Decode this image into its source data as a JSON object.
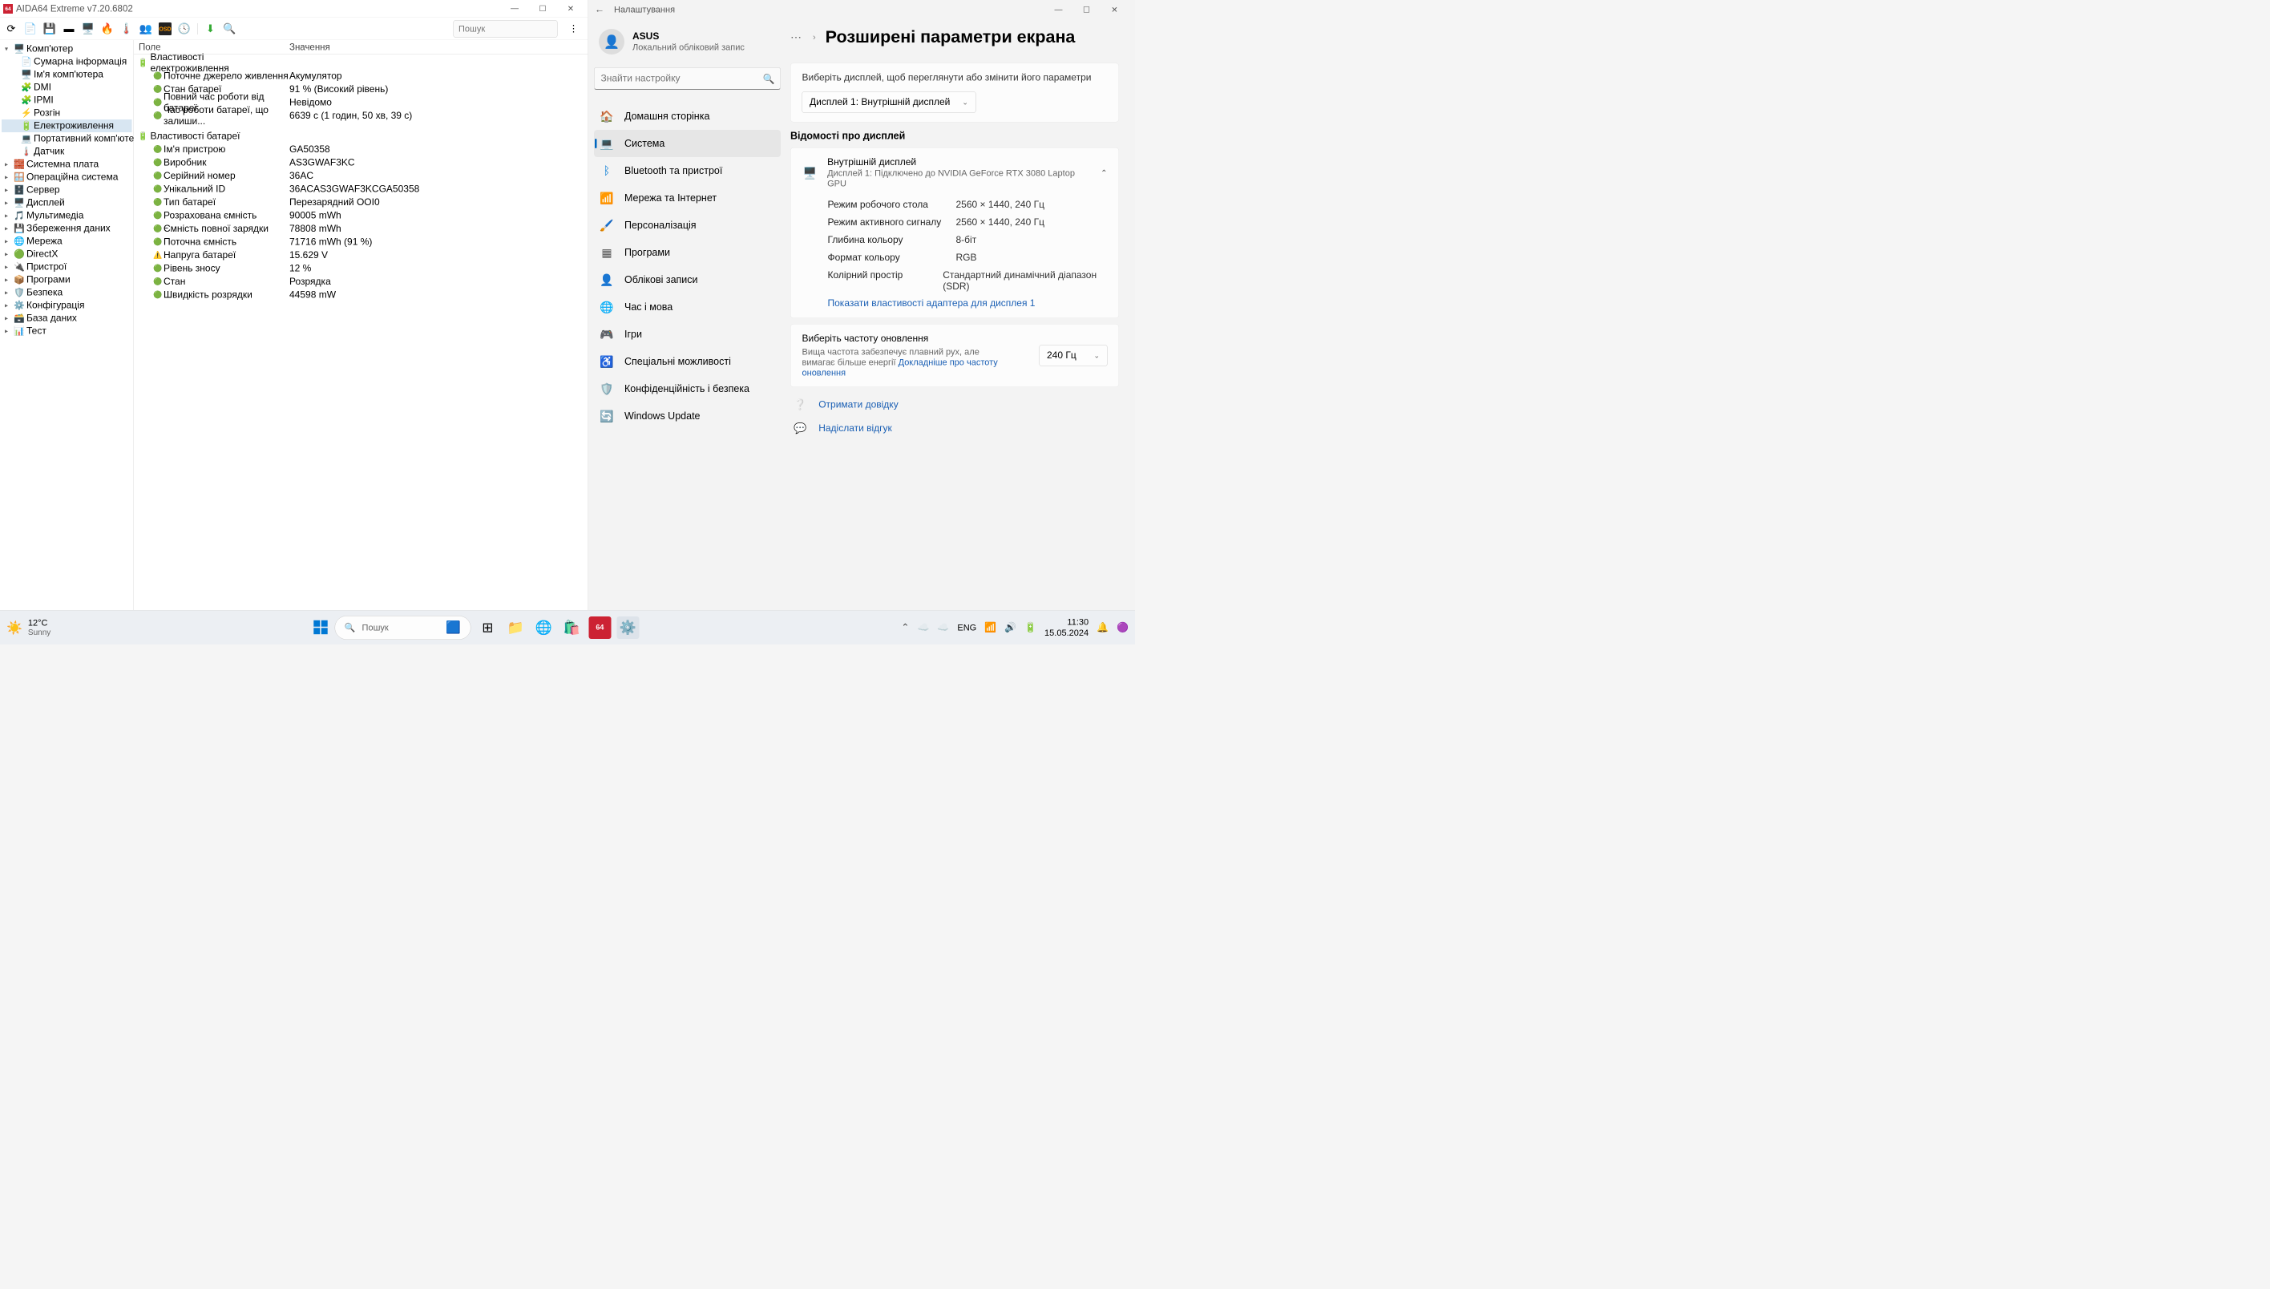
{
  "aida": {
    "title": "AIDA64 Extreme v7.20.6802",
    "icon": "64",
    "search_placeholder": "Пошук",
    "tree": {
      "root": "Комп'ютер",
      "children": [
        {
          "label": "Сумарна інформація",
          "icon": "📄"
        },
        {
          "label": "Ім'я комп'ютера",
          "icon": "🖥️"
        },
        {
          "label": "DMI",
          "icon": "🧩"
        },
        {
          "label": "IPMI",
          "icon": "🧩"
        },
        {
          "label": "Розгін",
          "icon": "⚡"
        },
        {
          "label": "Електроживлення",
          "icon": "🔋",
          "selected": true
        },
        {
          "label": "Портативний комп'ютер",
          "icon": "💻"
        },
        {
          "label": "Датчик",
          "icon": "🌡️"
        }
      ],
      "top_level": [
        {
          "label": "Системна плата",
          "icon": "🧱"
        },
        {
          "label": "Операційна система",
          "icon": "🪟"
        },
        {
          "label": "Сервер",
          "icon": "🗄️"
        },
        {
          "label": "Дисплей",
          "icon": "🖥️"
        },
        {
          "label": "Мультимедіа",
          "icon": "🎵"
        },
        {
          "label": "Збереження даних",
          "icon": "💾"
        },
        {
          "label": "Мережа",
          "icon": "🌐"
        },
        {
          "label": "DirectX",
          "icon": "🟢"
        },
        {
          "label": "Пристрої",
          "icon": "🔌"
        },
        {
          "label": "Програми",
          "icon": "📦"
        },
        {
          "label": "Безпека",
          "icon": "🛡️"
        },
        {
          "label": "Конфігурація",
          "icon": "⚙️"
        },
        {
          "label": "База даних",
          "icon": "🗃️"
        },
        {
          "label": "Тест",
          "icon": "📊"
        }
      ]
    },
    "header": {
      "col1": "Поле",
      "col2": "Значення"
    },
    "group1": {
      "title": "Властивості електроживлення",
      "rows": [
        {
          "f": "Поточне джерело живлення",
          "v": "Акумулятор"
        },
        {
          "f": "Стан батареї",
          "v": "91 % (Високий рівень)"
        },
        {
          "f": "Повний час роботи від батареї",
          "v": "Невідомо"
        },
        {
          "f": "Час роботи батареї, що залиши...",
          "v": "6639 с (1 годин, 50 хв, 39 с)"
        }
      ]
    },
    "group2": {
      "title": "Властивості батареї",
      "rows": [
        {
          "f": "Ім'я пристрою",
          "v": "GA50358"
        },
        {
          "f": "Виробник",
          "v": "AS3GWAF3KC"
        },
        {
          "f": "Серійний номер",
          "v": "36AC"
        },
        {
          "f": "Унікальний ID",
          "v": "36ACAS3GWAF3KCGA50358"
        },
        {
          "f": "Тип батареї",
          "v": "Перезарядний OOI0"
        },
        {
          "f": "Розрахована ємність",
          "v": "90005 mWh"
        },
        {
          "f": "Ємність повної зарядки",
          "v": "78808 mWh"
        },
        {
          "f": "Поточна ємність",
          "v": "71716 mWh  (91 %)"
        },
        {
          "f": "Напруга батареї",
          "v": "15.629 V",
          "icon": "⚠️"
        },
        {
          "f": "Рівень зносу",
          "v": "12 %"
        },
        {
          "f": "Стан",
          "v": "Розрядка"
        },
        {
          "f": "Швидкість розрядки",
          "v": "44598 mW"
        }
      ]
    }
  },
  "settings": {
    "back": "←",
    "title": "Налаштування",
    "user": {
      "name": "ASUS",
      "sub": "Локальний обліковий запис"
    },
    "search_placeholder": "Знайти настройку",
    "nav": [
      {
        "label": "Домашня сторінка",
        "icon": "🏠"
      },
      {
        "label": "Система",
        "icon": "💻",
        "active": true
      },
      {
        "label": "Bluetooth та пристрої",
        "icon": "ᛒ",
        "color": "#0078d4"
      },
      {
        "label": "Мережа та Інтернет",
        "icon": "📶"
      },
      {
        "label": "Персоналізація",
        "icon": "🖌️"
      },
      {
        "label": "Програми",
        "icon": "▦",
        "color": "#555"
      },
      {
        "label": "Облікові записи",
        "icon": "👤"
      },
      {
        "label": "Час і мова",
        "icon": "🌐"
      },
      {
        "label": "Ігри",
        "icon": "🎮"
      },
      {
        "label": "Спеціальні можливості",
        "icon": "♿"
      },
      {
        "label": "Конфіденційність і безпека",
        "icon": "🛡️"
      },
      {
        "label": "Windows Update",
        "icon": "🔄"
      }
    ],
    "breadcrumb": {
      "dots": "⋯",
      "sep": "›",
      "title": "Розширені параметри екрана"
    },
    "sel_display": {
      "prompt": "Виберіть дисплей, щоб переглянути або змінити його параметри",
      "value": "Дисплей 1: Внутрішній дисплей"
    },
    "info_title": "Відомості про дисплей",
    "display": {
      "title": "Внутрішній дисплей",
      "sub": "Дисплей 1: Підключено до NVIDIA GeForce RTX 3080 Laptop GPU",
      "props": [
        {
          "l": "Режим робочого стола",
          "v": "2560 × 1440, 240 Гц"
        },
        {
          "l": "Режим активного сигналу",
          "v": "2560 × 1440, 240 Гц"
        },
        {
          "l": "Глибина кольору",
          "v": "8-біт"
        },
        {
          "l": "Формат кольору",
          "v": "RGB"
        },
        {
          "l": "Колірний простір",
          "v": "Стандартний динамічний діапазон (SDR)"
        }
      ],
      "adapter_link": "Показати властивості адаптера для дисплея 1"
    },
    "refresh": {
      "title": "Виберіть частоту оновлення",
      "desc": "Вища частота забезпечує плавний рух, але вимагає більше енергії ",
      "link": "Докладніше про частоту оновлення",
      "value": "240 Гц"
    },
    "help": {
      "label": "Отримати довідку"
    },
    "feedback": {
      "label": "Надіслати відгук"
    }
  },
  "taskbar": {
    "temp": "12°C",
    "weather": "Sunny",
    "search": "Пошук",
    "lang": "ENG",
    "time": "11:30",
    "date": "15.05.2024"
  }
}
